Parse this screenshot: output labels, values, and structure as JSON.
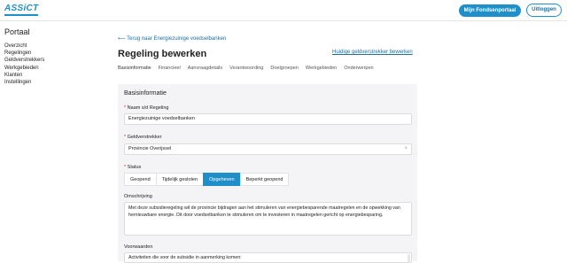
{
  "header": {
    "logo_text": "ASSiCT",
    "fund_portal_label": "Mijn Fondsenportaal",
    "logout_label": "Uitloggen",
    "brand_color": "#1f8fc9"
  },
  "sidebar": {
    "title": "Portaal",
    "items": [
      {
        "label": "Overzicht"
      },
      {
        "label": "Regelingen"
      },
      {
        "label": "Geldverstrekkers"
      },
      {
        "label": "Werkgebieden"
      },
      {
        "label": "Klanten"
      },
      {
        "label": "Instellingen"
      }
    ]
  },
  "main": {
    "back_link": "⟵ Terug naar Energiezuinige voedselbanken",
    "title": "Regeling bewerken",
    "edit_funder_link": "Huidige geldverstrekker bewerken",
    "tabs": [
      {
        "label": "Basisinformatie"
      },
      {
        "label": "Financieel"
      },
      {
        "label": "Aanvraagdetails"
      },
      {
        "label": "Verantwoording"
      },
      {
        "label": "Doelgroepen"
      },
      {
        "label": "Werkgebieden"
      },
      {
        "label": "Onderwerpen"
      }
    ]
  },
  "form": {
    "section_title": "Basisinformatie",
    "name_label": "Naam s/d Regeling",
    "name_value": "Energiezuinige voedselbanken",
    "funder_label": "Geldverstrekker",
    "funder_value": "Provincie Overijssel",
    "status_label": "Status",
    "status_options": [
      {
        "label": "Geopend",
        "selected": false
      },
      {
        "label": "Tijdelijk gesloten",
        "selected": false
      },
      {
        "label": "Opgeheven",
        "selected": true
      },
      {
        "label": "Beperkt geopend",
        "selected": false
      }
    ],
    "description_label": "Omschrijving",
    "description_value": "Met deze subsidieregeling wil de provincie bijdragen aan het stimuleren van energiebesparende maatregelen en de opwekking van hernieuwbare energie. Dit door voedselbanken te stimuleren om te investeren in maatregelen gericht op energiebesparing.",
    "conditions_label": "Voorwaarden",
    "conditions_value": "Activiteiten die voor de subsidie in aanmerking komen:",
    "required_marker": "*",
    "clear_symbol": "×"
  }
}
